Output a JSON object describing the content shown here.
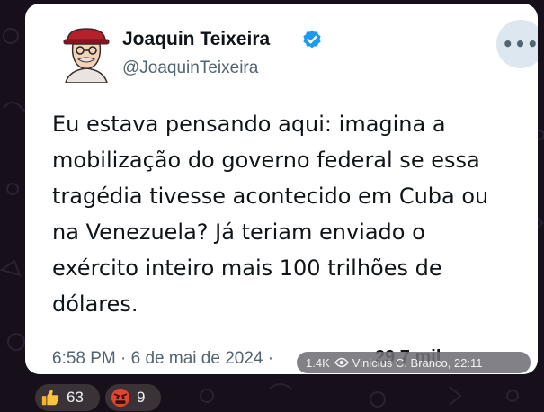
{
  "post": {
    "author_name": "Joaquin Teixeira",
    "author_handle": "@JoaquinTeixeira",
    "more_label": "•••",
    "text": "Eu estava pensando aqui: imagina a\nmobilização do governo federal se essa\ntragédia tivesse acontecido em Cuba ou\nna Venezuela? Já teriam enviado o\nexército inteiro mais 100 trilhões de\ndólares.",
    "timestamp": "6:58 PM · 6 de mai de 2024 ·",
    "views": "29,7 mil"
  },
  "message_overlay": {
    "view_count": "1.4K",
    "author_time": "Vinicius C. Branco, 22:11"
  },
  "reactions": [
    {
      "icon": "thumbs-up-icon",
      "count": "63"
    },
    {
      "icon": "angry-face-icon",
      "count": "9"
    }
  ],
  "colors": {
    "verified": "#1d9bf0",
    "background": "#17101b",
    "card": "#ffffff",
    "secondary_text": "#536471"
  }
}
